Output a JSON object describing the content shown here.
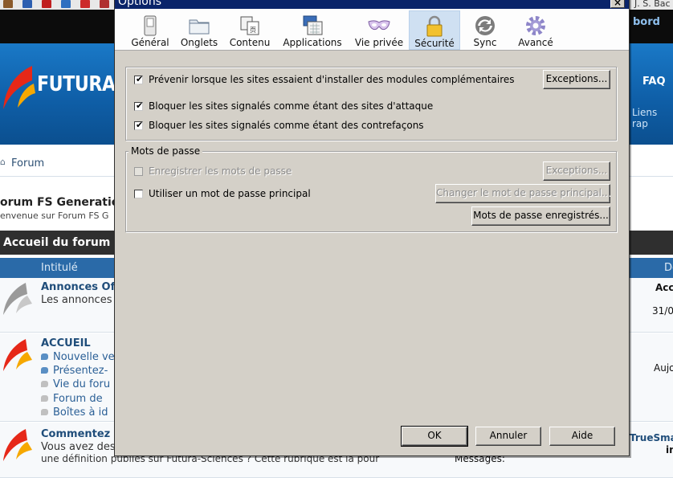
{
  "background": {
    "forum_logo": "FUTURA",
    "top_right_text": "J. S. Bac",
    "bord": "bord",
    "faq": "FAQ",
    "liens": "Liens rap",
    "breadcrumb": "Forum",
    "forum_title": "orum FS Generatio",
    "welcome": "envenue sur Forum FS G",
    "accueil_bar": "Accueil du forum",
    "col_intitule": "Intitulé",
    "col_right": "De",
    "rows": [
      {
        "title": "Annonces Of",
        "text": "Les annonces",
        "right1": "Acc",
        "right2": "31/0"
      },
      {
        "title": "ACCUEIL",
        "subs": [
          "Nouvelle ve",
          "Présentez-",
          "Vie du foru",
          "Forum de",
          "Boîtes à id"
        ],
        "right1": "Aujo"
      },
      {
        "title": "Commentez l",
        "text1": "Vous avez des",
        "text2": "une définition publiés sur Futura-Sciences ? Cette rubrique est là pour",
        "right1": "TrueSma",
        "right2": "in",
        "bottom": "Messages:"
      }
    ]
  },
  "dialog": {
    "title": "Options",
    "close_label": "×",
    "tabs": [
      {
        "label": "Général",
        "icon": "general-switch-icon"
      },
      {
        "label": "Onglets",
        "icon": "tabs-folder-icon"
      },
      {
        "label": "Contenu",
        "icon": "content-page-icon"
      },
      {
        "label": "Applications",
        "icon": "applications-icon"
      },
      {
        "label": "Vie privée",
        "icon": "privacy-mask-icon"
      },
      {
        "label": "Sécurité",
        "icon": "security-lock-icon",
        "active": true
      },
      {
        "label": "Sync",
        "icon": "sync-icon"
      },
      {
        "label": "Avancé",
        "icon": "advanced-gear-icon"
      }
    ],
    "security": {
      "warn_addons": {
        "label": "Prévenir lorsque les sites essaient d'installer des modules complémentaires",
        "checked": true
      },
      "exceptions1": "Exceptions...",
      "block_attack": {
        "label": "Bloquer les sites signalés comme étant des sites d'attaque",
        "checked": true
      },
      "block_forgery": {
        "label": "Bloquer les sites signalés comme étant des contrefaçons",
        "checked": true
      }
    },
    "passwords": {
      "legend": "Mots de passe",
      "remember": {
        "label": "Enregistrer les mots de passe",
        "checked": false,
        "disabled": true
      },
      "exceptions2": "Exceptions...",
      "master": {
        "label": "Utiliser un mot de passe principal",
        "checked": false
      },
      "change_master": "Changer le mot de passe principal...",
      "saved_passwords": "Mots de passe enregistrés..."
    },
    "buttons": {
      "ok": "OK",
      "cancel": "Annuler",
      "help": "Aide"
    }
  }
}
